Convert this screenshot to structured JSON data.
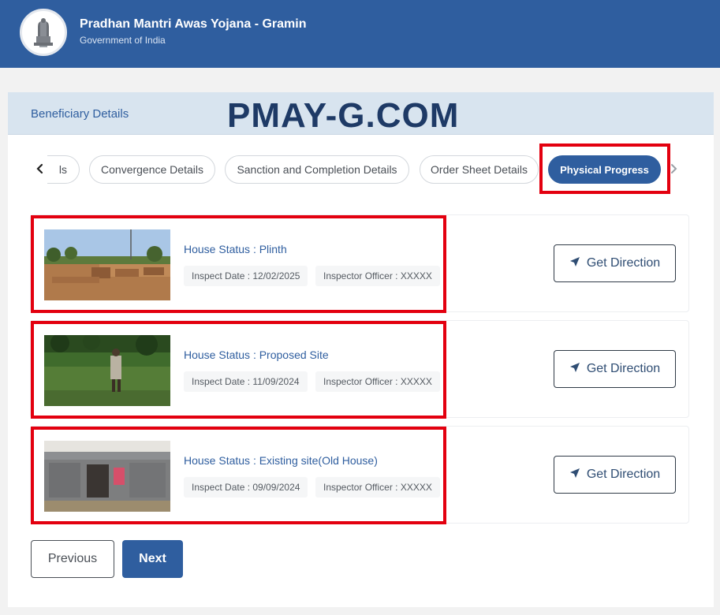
{
  "header": {
    "title": "Pradhan Mantri Awas Yojana - Gramin",
    "subtitle": "Government of India",
    "logo_icon": "national-emblem-icon"
  },
  "section": {
    "title": "Beneficiary Details",
    "watermark": "PMAY-G.COM"
  },
  "tabs": {
    "prev_icon": "chevron-left-icon",
    "next_icon": "chevron-right-icon",
    "items": [
      {
        "label": "ls",
        "active": false
      },
      {
        "label": "Convergence Details",
        "active": false
      },
      {
        "label": "Sanction and Completion Details",
        "active": false
      },
      {
        "label": "Order Sheet Details",
        "active": false
      },
      {
        "label": "Physical Progress",
        "active": true
      }
    ]
  },
  "records": [
    {
      "status": "House Status : Plinth",
      "inspect_date": "Inspect Date : 12/02/2025",
      "officer": "Inspector Officer : XXXXX",
      "button": "Get Direction",
      "photo": "plinth-construction-photo"
    },
    {
      "status": "House Status : Proposed Site",
      "inspect_date": "Inspect Date : 11/09/2024",
      "officer": "Inspector Officer : XXXXX",
      "button": "Get Direction",
      "photo": "proposed-site-photo"
    },
    {
      "status": "House Status : Existing site(Old House)",
      "inspect_date": "Inspect Date : 09/09/2024",
      "officer": "Inspector Officer : XXXXX",
      "button": "Get Direction",
      "photo": "old-house-photo"
    }
  ],
  "pagination": {
    "previous": "Previous",
    "next": "Next"
  },
  "colors": {
    "primary": "#2f5e9f",
    "highlight": "#e3000f",
    "section_bg": "#d8e4ef",
    "watermark": "#1e3a66"
  }
}
